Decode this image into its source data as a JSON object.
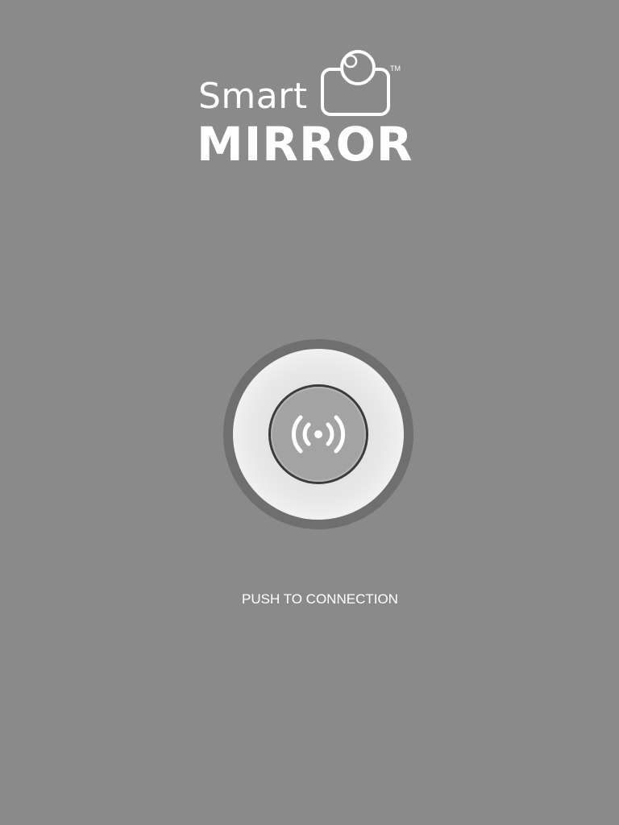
{
  "logo": {
    "line1": "Smart",
    "line2": "MIRROR",
    "trademark": "TM",
    "icon": "camera-icon"
  },
  "connect_button": {
    "icon": "broadcast-signal-icon",
    "label": "PUSH TO CONNECTION"
  },
  "colors": {
    "background": "#8a8a8a",
    "text": "#ffffff",
    "outer_ring": "#6f6f6f",
    "inner_button": "#a3a3a3"
  }
}
